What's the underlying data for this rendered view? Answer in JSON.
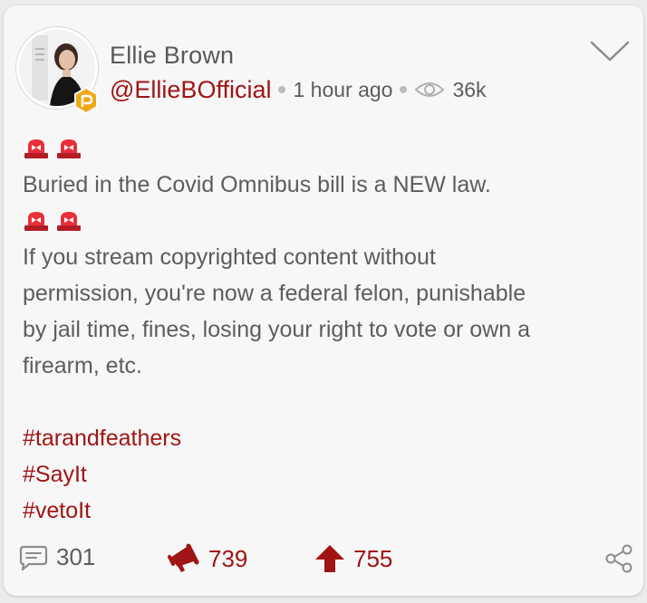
{
  "post": {
    "author_name": "Ellie Brown",
    "handle": "@EllieBOfficial",
    "time": "1 hour ago",
    "views": "36k",
    "icons": {
      "badge": "parler-badge-icon",
      "views": "eye-icon",
      "menu": "chevron-down-icon",
      "alert": "police-light-emoji"
    },
    "body_lines_1": [
      "Buried in the Covid Omnibus bill is a NEW law."
    ],
    "body_lines_2": [
      "If you stream copyrighted content without",
      "permission, you're now a federal felon, punishable",
      "by jail time, fines, losing your right to vote or own a",
      "firearm, etc."
    ],
    "hashtags": [
      "#tarandfeathers",
      "#SayIt",
      "#vetoIt"
    ]
  },
  "actions": {
    "comments": "301",
    "echoes": "739",
    "upvotes": "755",
    "icons": {
      "comments": "comment-icon",
      "echoes": "megaphone-icon",
      "upvotes": "upvote-arrow-icon",
      "share": "share-icon"
    }
  },
  "colors": {
    "accent": "#a01414",
    "text": "#5a5d60",
    "badge": "#f0a818",
    "card": "#f7f7f7"
  }
}
